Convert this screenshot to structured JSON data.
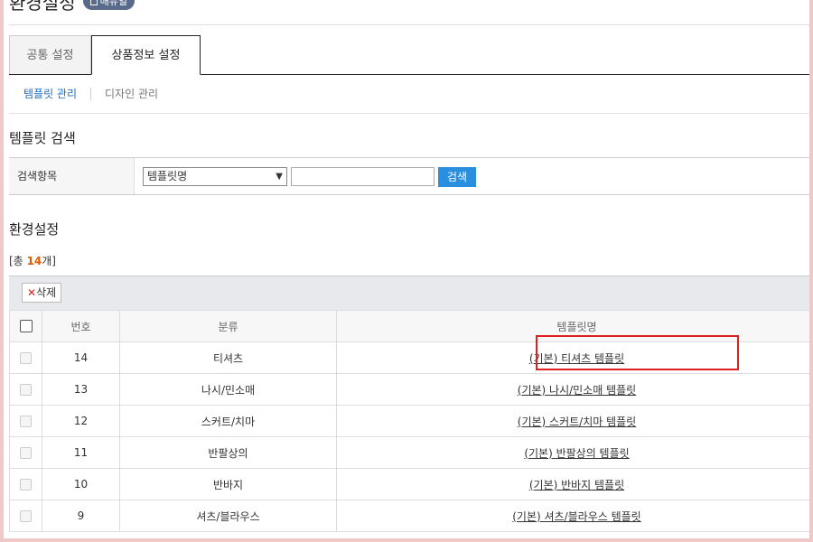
{
  "header": {
    "title": "환경설정",
    "manual_label": "매뉴얼"
  },
  "tabs": [
    {
      "label": "공통 설정",
      "active": false
    },
    {
      "label": "상품정보 설정",
      "active": true
    }
  ],
  "subnav": {
    "active": "템플릿 관리",
    "inactive": "디자인 관리"
  },
  "search": {
    "title": "템플릿 검색",
    "label": "검색항목",
    "select_value": "템플릿명",
    "input_value": "",
    "button": "검색"
  },
  "settings": {
    "title": "환경설정",
    "total_prefix": "[총 ",
    "total_count": "14",
    "total_suffix": "개]",
    "delete_button": "삭제"
  },
  "table": {
    "columns": [
      "번호",
      "분류",
      "템플릿명"
    ],
    "rows": [
      {
        "no": "14",
        "category": "티셔츠",
        "name": "(기본) 티셔츠 템플릿"
      },
      {
        "no": "13",
        "category": "나시/민소매",
        "name": "(기본) 나시/민소매 템플릿"
      },
      {
        "no": "12",
        "category": "스커트/치마",
        "name": "(기본) 스커트/치마 템플릿"
      },
      {
        "no": "11",
        "category": "반팔상의",
        "name": "(기본) 반팔상의 템플릿"
      },
      {
        "no": "10",
        "category": "반바지",
        "name": "(기본) 반바지 템플릿"
      },
      {
        "no": "9",
        "category": "셔츠/블라우스",
        "name": "(기본) 셔츠/블라우스 템플릿"
      }
    ]
  },
  "colors": {
    "accent": "#2b8fe0",
    "count": "#e05a00",
    "highlight": "#e02020"
  }
}
